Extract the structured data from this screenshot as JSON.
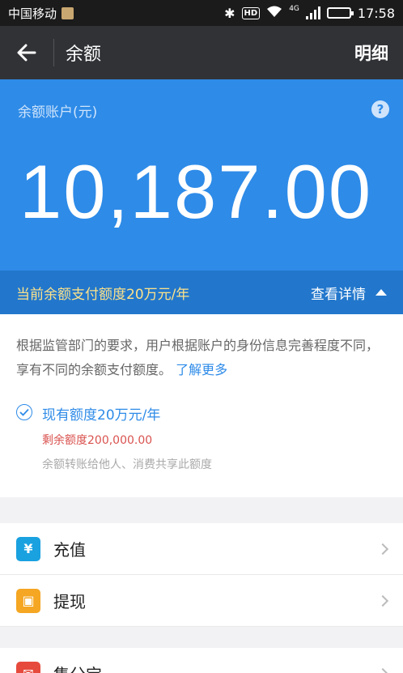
{
  "status": {
    "carrier": "中国移动",
    "hd": "HD",
    "network": "4G",
    "time": "17:58"
  },
  "titlebar": {
    "title": "余额",
    "detail_label": "明细"
  },
  "balance": {
    "account_label": "余额账户(元)",
    "amount": "10,187.00"
  },
  "quota": {
    "text": "当前余额支付额度20万元/年",
    "link_label": "查看详情"
  },
  "info": {
    "description": "根据监管部门的要求，用户根据账户的身份信息完善程度不同，享有不同的余额支付额度。",
    "more_link": "了解更多",
    "limit_title": "现有额度20万元/年",
    "remaining": "剩余额度200,000.00",
    "note": "余额转账给他人、消费共享此额度"
  },
  "actions": [
    {
      "label": "充值",
      "icon": "yen-icon",
      "color": "#1aa1e0",
      "glyph": "¥"
    },
    {
      "label": "提现",
      "icon": "wallet-icon",
      "color": "#f5a623",
      "glyph": "▣"
    },
    {
      "label": "集分宝",
      "icon": "envelope-icon",
      "color": "#e64a3c",
      "glyph": "✉"
    }
  ]
}
